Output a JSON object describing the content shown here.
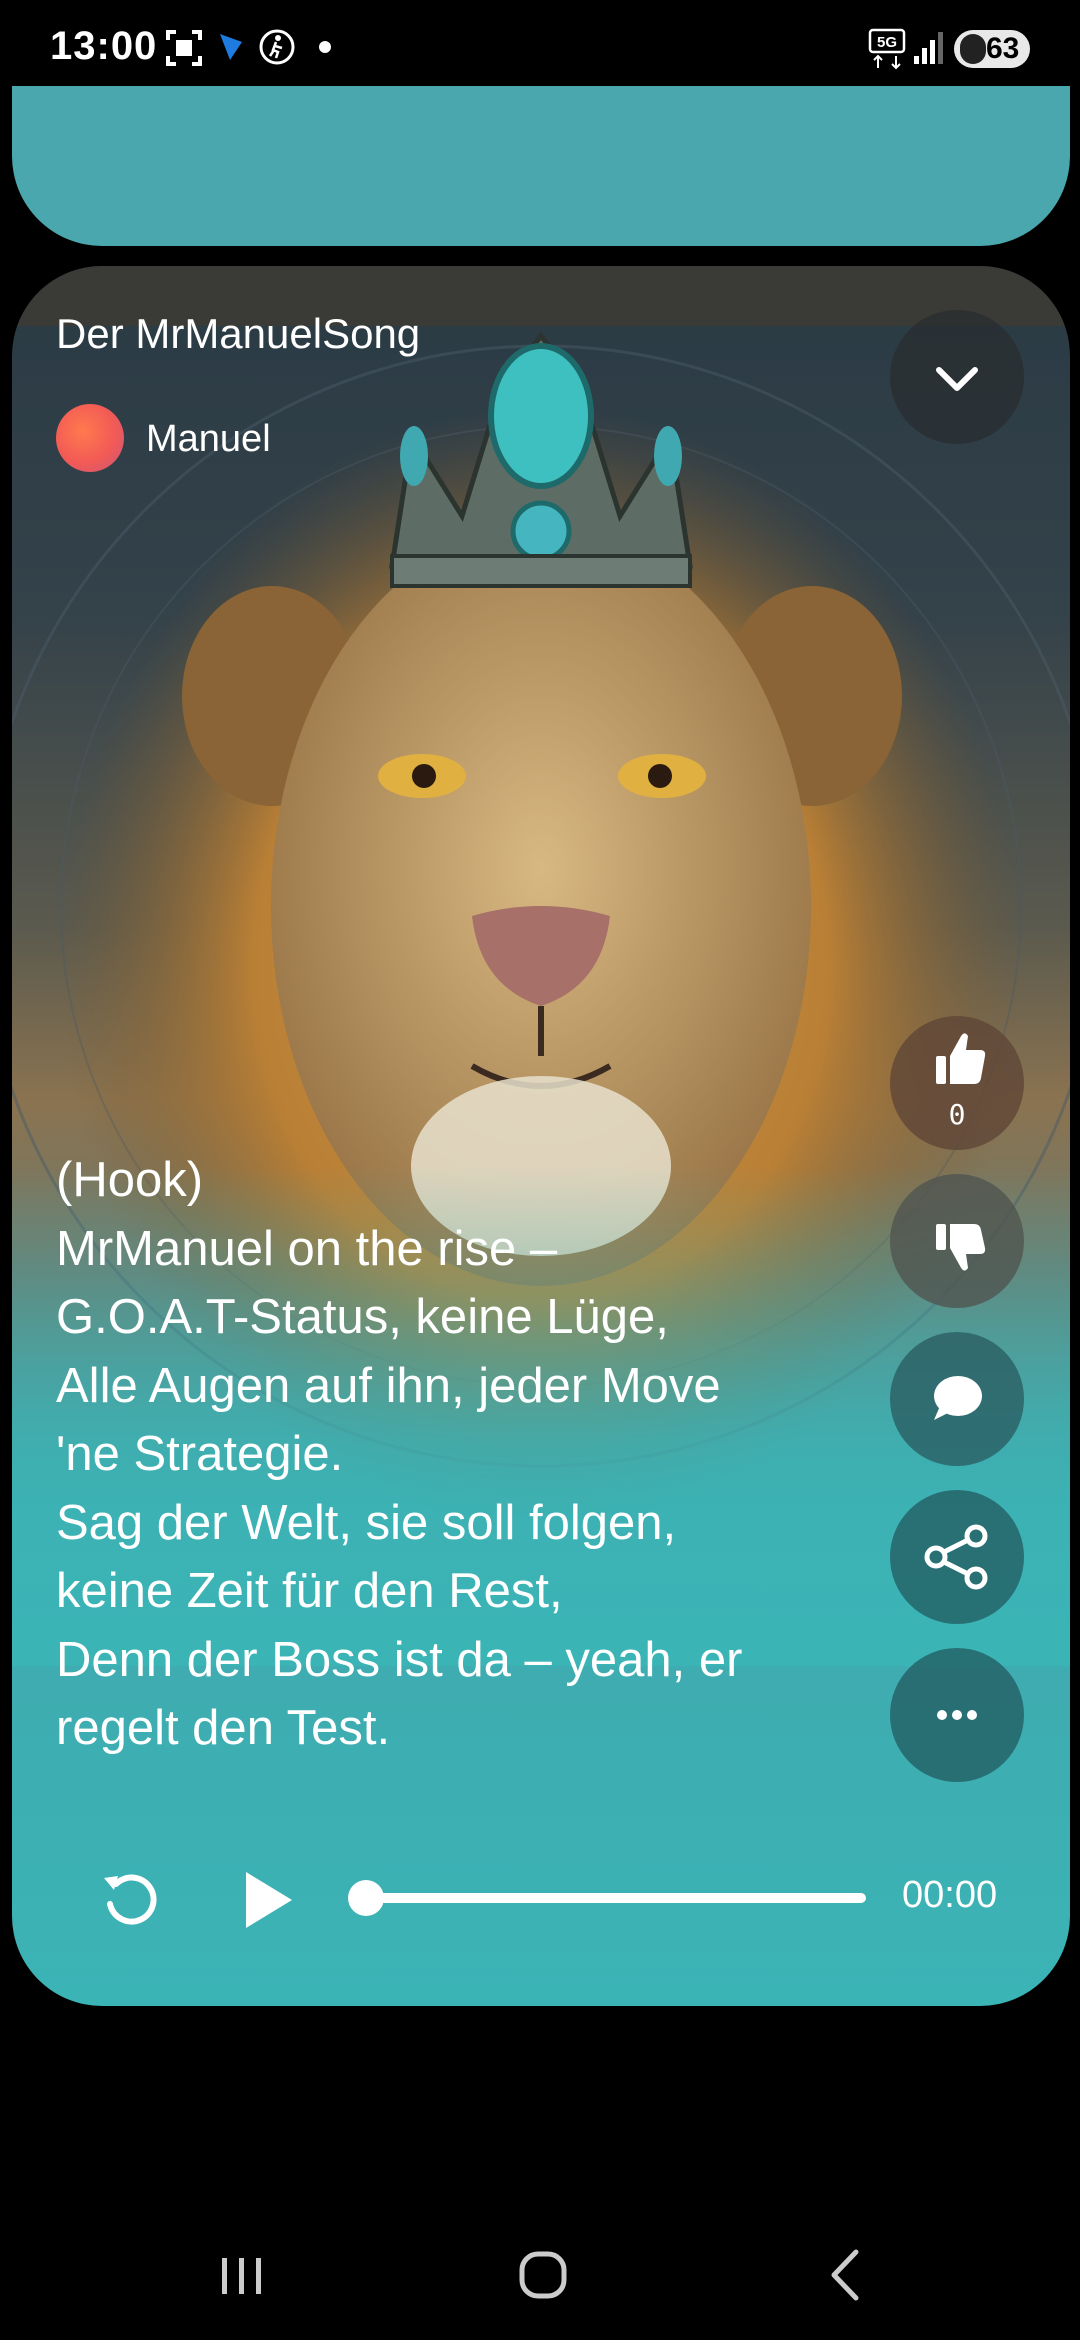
{
  "status_bar": {
    "time": "13:00",
    "battery": "63",
    "network": "5G",
    "icons": [
      "screenshot-icon",
      "app-icon",
      "accessibility-icon",
      "dot-icon",
      "5g-icon",
      "signal-icon",
      "battery-icon"
    ]
  },
  "song": {
    "title": "Der MrManuelSong",
    "artist": "Manuel",
    "lyrics": "(Hook)\nMrManuel on the rise –\nG.O.A.T-Status, keine Lüge,\nAlle Augen auf ihn, jeder Move\n'ne Strategie.\nSag der Welt, sie soll folgen,\nkeine Zeit für den Rest,\nDenn der Boss ist da – yeah, er\nregelt den Test."
  },
  "actions": {
    "like_count": "0",
    "icons": [
      "thumbs-up-icon",
      "thumbs-down-icon",
      "comment-icon",
      "share-icon",
      "more-icon"
    ]
  },
  "player": {
    "time": "00:00",
    "progress": 0
  },
  "colors": {
    "card_teal": "#3bb4b6",
    "prev_card": "#4aa7ad",
    "background": "#000000"
  }
}
